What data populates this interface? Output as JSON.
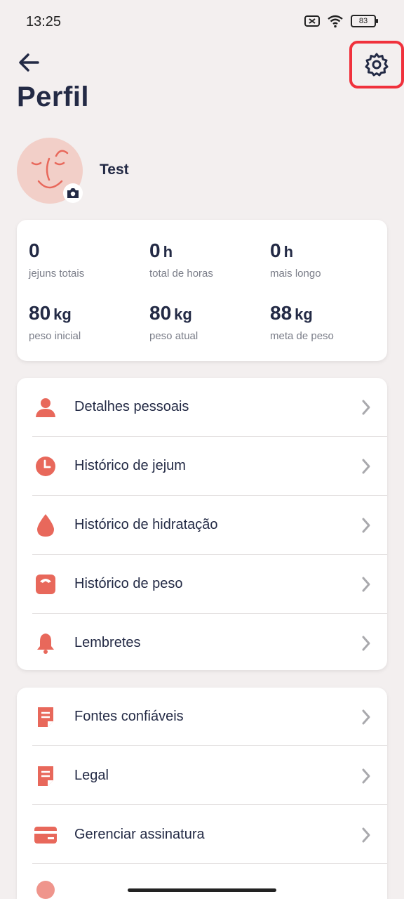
{
  "status_bar": {
    "time": "13:25",
    "battery": "83"
  },
  "header": {
    "title": "Perfil"
  },
  "profile": {
    "name": "Test"
  },
  "stats": [
    {
      "value": "0",
      "unit": "",
      "label": "jejuns totais"
    },
    {
      "value": "0",
      "unit": "h",
      "label": "total de horas"
    },
    {
      "value": "0",
      "unit": "h",
      "label": "mais longo"
    },
    {
      "value": "80",
      "unit": "kg",
      "label": "peso inicial"
    },
    {
      "value": "80",
      "unit": "kg",
      "label": "peso atual"
    },
    {
      "value": "88",
      "unit": "kg",
      "label": "meta de peso"
    }
  ],
  "menu_main": [
    {
      "label": "Detalhes pessoais",
      "icon": "person-icon"
    },
    {
      "label": "Histórico de jejum",
      "icon": "clock-icon"
    },
    {
      "label": "Histórico de hidratação",
      "icon": "water-drop-icon"
    },
    {
      "label": "Histórico de peso",
      "icon": "scale-icon"
    },
    {
      "label": "Lembretes",
      "icon": "bell-icon"
    }
  ],
  "menu_secondary": [
    {
      "label": "Fontes confiáveis",
      "icon": "document-icon"
    },
    {
      "label": "Legal",
      "icon": "document-icon"
    },
    {
      "label": "Gerenciar assinatura",
      "icon": "credit-card-icon"
    }
  ],
  "colors": {
    "accent": "#e8685b",
    "text": "#232a45",
    "background": "#f3efef",
    "highlight": "#f0313c"
  }
}
